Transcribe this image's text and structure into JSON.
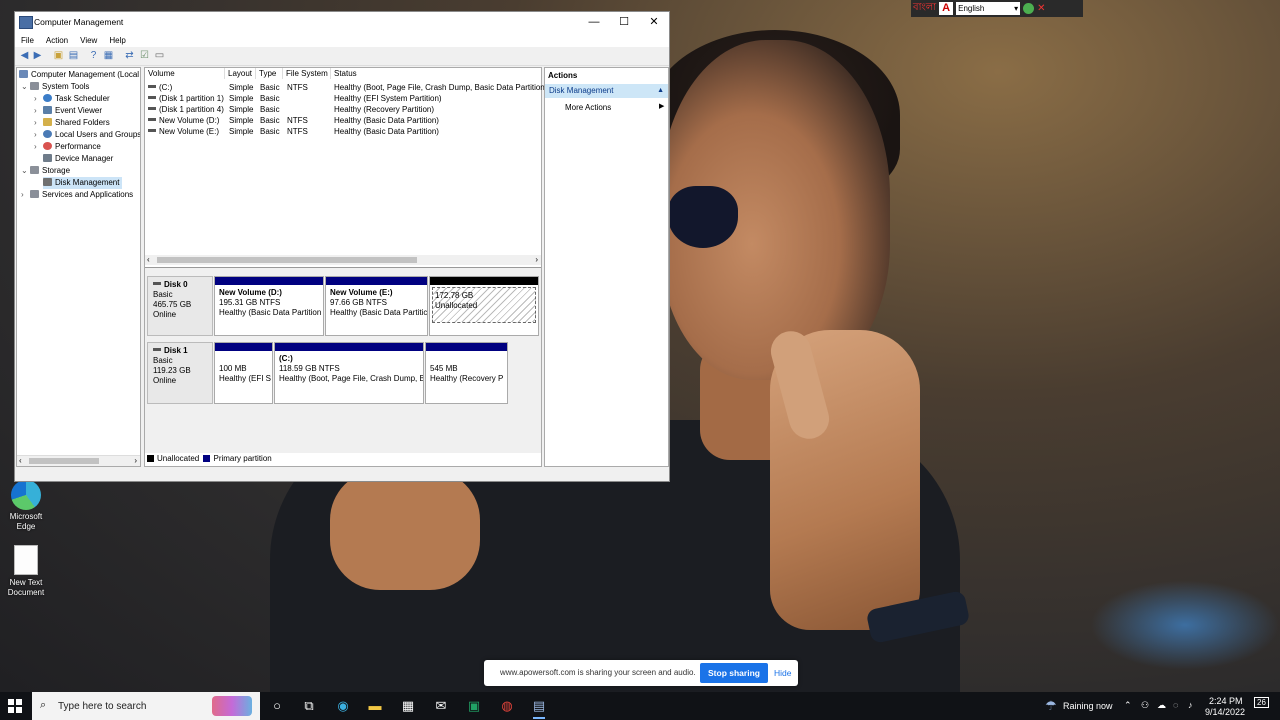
{
  "window": {
    "title": "Computer Management",
    "buttons": {
      "minimize": "—",
      "maximize": "☐",
      "close": "✕"
    },
    "menu": [
      "File",
      "Action",
      "View",
      "Help"
    ]
  },
  "tree": {
    "root": "Computer Management (Local",
    "system_tools": "System Tools",
    "task_scheduler": "Task Scheduler",
    "event_viewer": "Event Viewer",
    "shared_folders": "Shared Folders",
    "local_users": "Local Users and Groups",
    "performance": "Performance",
    "device_manager": "Device Manager",
    "storage": "Storage",
    "disk_management": "Disk Management",
    "services": "Services and Applications"
  },
  "volume_list": {
    "headers": [
      "Volume",
      "Layout",
      "Type",
      "File System",
      "Status"
    ],
    "rows": [
      {
        "volume": "(C:)",
        "layout": "Simple",
        "type": "Basic",
        "fs": "NTFS",
        "status": "Healthy (Boot, Page File, Crash Dump, Basic Data Partition)"
      },
      {
        "volume": "(Disk 1 partition 1)",
        "layout": "Simple",
        "type": "Basic",
        "fs": "",
        "status": "Healthy (EFI System Partition)"
      },
      {
        "volume": "(Disk 1 partition 4)",
        "layout": "Simple",
        "type": "Basic",
        "fs": "",
        "status": "Healthy (Recovery Partition)"
      },
      {
        "volume": "New Volume (D:)",
        "layout": "Simple",
        "type": "Basic",
        "fs": "NTFS",
        "status": "Healthy (Basic Data Partition)"
      },
      {
        "volume": "New Volume (E:)",
        "layout": "Simple",
        "type": "Basic",
        "fs": "NTFS",
        "status": "Healthy (Basic Data Partition)"
      }
    ]
  },
  "disks": {
    "disk0": {
      "name": "Disk 0",
      "type": "Basic",
      "size": "465.75 GB",
      "state": "Online",
      "partitions": [
        {
          "name": "New Volume  (D:)",
          "size": "195.31 GB NTFS",
          "status": "Healthy (Basic Data Partition"
        },
        {
          "name": "New Volume  (E:)",
          "size": "97.66 GB NTFS",
          "status": "Healthy (Basic Data Partitic"
        },
        {
          "name": "",
          "size": "172.78 GB",
          "status": "Unallocated"
        }
      ]
    },
    "disk1": {
      "name": "Disk 1",
      "type": "Basic",
      "size": "119.23 GB",
      "state": "Online",
      "partitions": [
        {
          "name": "",
          "size": "100 MB",
          "status": "Healthy (EFI S"
        },
        {
          "name": "(C:)",
          "size": "118.59 GB NTFS",
          "status": "Healthy (Boot, Page File, Crash Dump, B"
        },
        {
          "name": "",
          "size": "545 MB",
          "status": "Healthy (Recovery P"
        }
      ]
    }
  },
  "legend": {
    "unallocated": "Unallocated",
    "primary": "Primary partition"
  },
  "actions": {
    "header": "Actions",
    "section": "Disk Management",
    "more": "More Actions"
  },
  "desktop": {
    "edge_label": "Microsoft Edge",
    "text_doc_label": "New Text Document"
  },
  "langbar": {
    "language": "English",
    "bangla": "বাংলা"
  },
  "sharing": {
    "message": "www.apowersoft.com is sharing your screen and audio.",
    "stop": "Stop sharing",
    "hide": "Hide"
  },
  "taskbar": {
    "search_placeholder": "Type here to search",
    "weather": "Raining now",
    "time": "2:24 PM",
    "date": "9/14/2022",
    "notifications": "26"
  },
  "colors": {
    "primary_partition": "#000080",
    "unallocated": "#000000",
    "accent": "#1a73e8"
  }
}
